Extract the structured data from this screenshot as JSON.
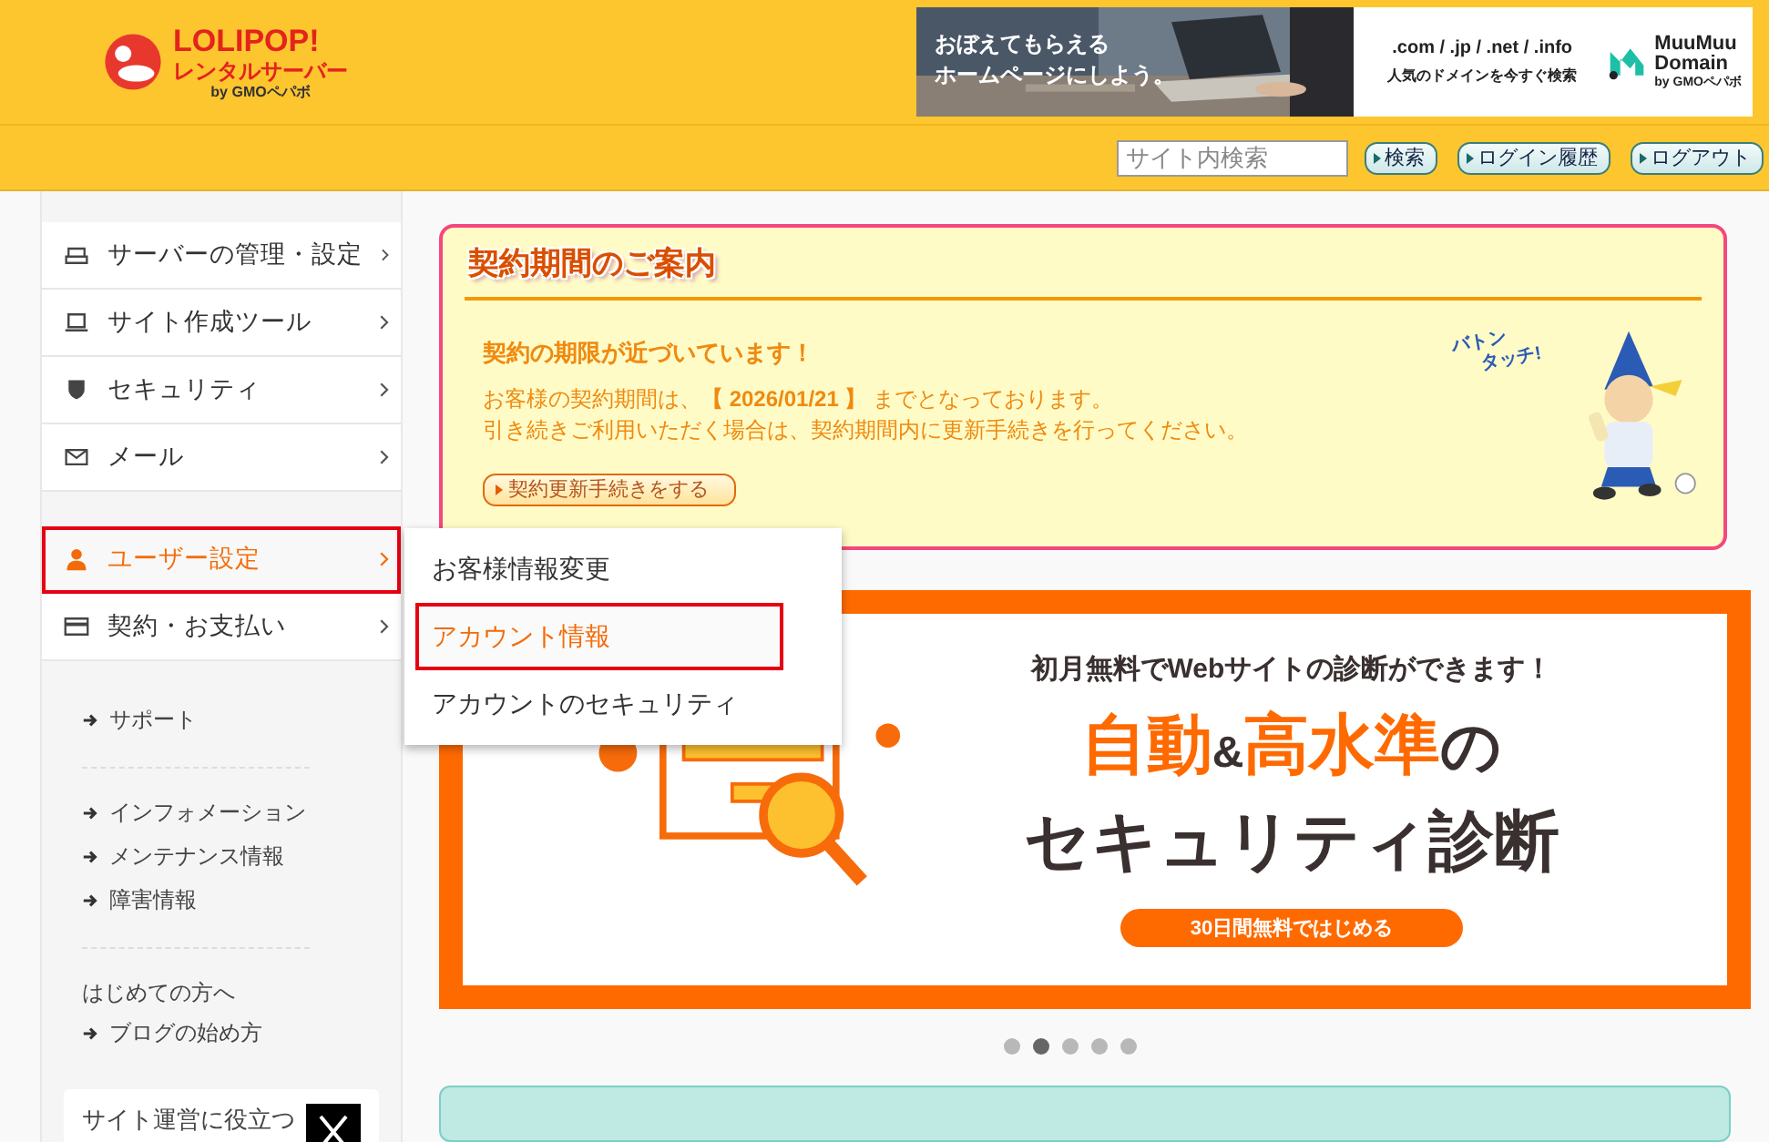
{
  "header": {
    "logo": {
      "name": "LOLIPOP!",
      "sub": "レンタルサーバー",
      "by": "by GMOペパボ"
    },
    "ad": {
      "line1": "おぼえてもらえる",
      "line2": "ホームページにしよう。",
      "domains": ".com / .jp / .net / .info",
      "tagline": "人気のドメインを今すぐ検索",
      "brand1": "MuuMuu",
      "brand2": "Domain",
      "brand_by": "by GMOペパボ"
    }
  },
  "toolbar": {
    "search": {
      "placeholder": "サイト内検索"
    },
    "buttons": [
      "検索",
      "ログイン履歴",
      "ログアウト"
    ]
  },
  "sidebar": {
    "menu": [
      {
        "label": "サーバーの管理・設定",
        "kind": "printer",
        "selected": false
      },
      {
        "label": "サイト作成ツール",
        "kind": "laptop",
        "selected": false
      },
      {
        "label": "セキュリティ",
        "kind": "shield",
        "selected": false
      },
      {
        "label": "メール",
        "kind": "mail",
        "selected": false
      },
      {
        "label": "ユーザー設定",
        "kind": "user",
        "selected": true
      },
      {
        "label": "契約・お支払い",
        "kind": "card",
        "selected": false
      }
    ],
    "link_groups": [
      [
        {
          "label": "サポート",
          "kind": "arrow"
        }
      ],
      [
        {
          "label": "インフォメーション",
          "kind": "arrow"
        },
        {
          "label": "メンテナンス情報",
          "kind": "arrow"
        },
        {
          "label": "障害情報",
          "kind": "arrow"
        }
      ],
      [
        {
          "label": "はじめての方へ",
          "kind": "plain"
        },
        {
          "label": "ブログの始め方",
          "kind": "arrow"
        }
      ]
    ],
    "promo": {
      "text": "サイト運営に役立つ"
    }
  },
  "submenu": [
    {
      "label": "お客様情報変更",
      "selected": false
    },
    {
      "label": "アカウント情報",
      "selected": true
    },
    {
      "label": "アカウントのセキュリティ",
      "selected": false
    }
  ],
  "notice": {
    "title": "契約期間のご案内",
    "heading": "契約の期限が近づいています！",
    "body": [
      "お客様の契約期間は、**【 2026/01/21 】** までとなっております。",
      "引き続きご利用いただく場合は、契約期間内に更新手続きを行ってください。"
    ],
    "button": "契約更新手続きをする",
    "mascot_bubble": [
      "バトン",
      "タッチ!"
    ]
  },
  "banner": {
    "lead": "初月無料でWebサイトの診断ができます！",
    "headline": [
      {
        "text": "自動",
        "kind": "accent"
      },
      {
        "text": "&",
        "kind": "small"
      },
      {
        "text": "高水準",
        "kind": "accent"
      },
      {
        "text": "の",
        "kind": "plain"
      }
    ],
    "headline2": "セキュリティ診断",
    "cta": "30日間無料ではじめる"
  },
  "carousel": [
    {
      "selected": false
    },
    {
      "selected": true
    },
    {
      "selected": false
    },
    {
      "selected": false
    },
    {
      "selected": false
    }
  ]
}
